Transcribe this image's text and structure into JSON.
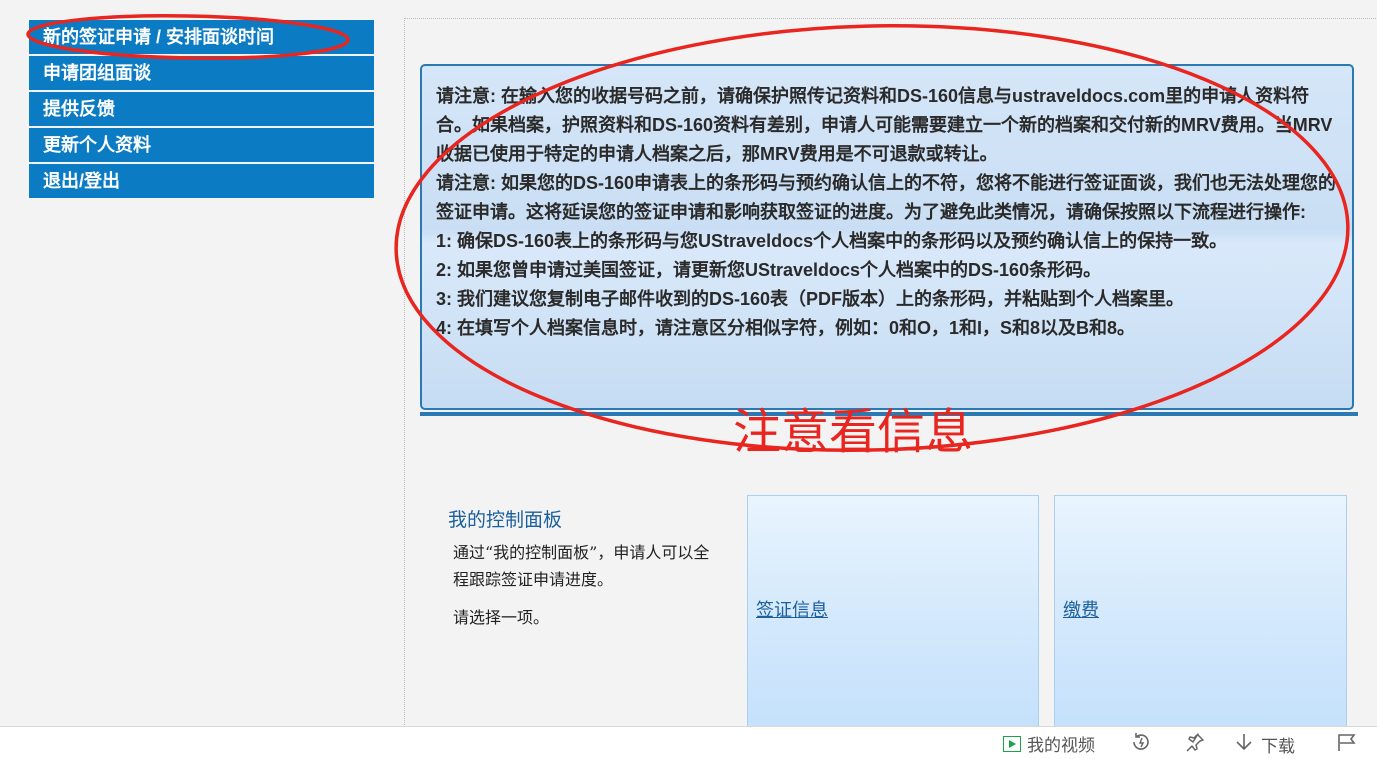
{
  "nav": {
    "items": [
      {
        "label": "新的签证申请 / 安排面谈时间"
      },
      {
        "label": "申请团组面谈"
      },
      {
        "label": "提供反馈"
      },
      {
        "label": "更新个人资料"
      },
      {
        "label": "退出/登出"
      }
    ]
  },
  "notice": {
    "p1": "请注意: 在输入您的收据号码之前，请确保护照传记资料和DS-160信息与ustraveldocs.com里的申请人资料符合。如果档案，护照资料和DS-160资料有差别，申请人可能需要建立一个新的档案和交付新的MRV费用。当MRV收据已使用于特定的申请人档案之后，那MRV费用是不可退款或转让。",
    "p2": "请注意: 如果您的DS-160申请表上的条形码与预约确认信上的不符，您将不能进行签证面谈，我们也无法处理您的签证申请。这将延误您的签证申请和影响获取签证的进度。为了避免此类情况，请确保按照以下流程进行操作:",
    "steps": [
      "1: 确保DS-160表上的条形码与您UStraveldocs个人档案中的条形码以及预约确认信上的保持一致。",
      "2: 如果您曾申请过美国签证，请更新您UStraveldocs个人档案中的DS-160条形码。",
      "3: 我们建议您复制电子邮件收到的DS-160表（PDF版本）上的条形码，并粘贴到个人档案里。",
      "4: 在填写个人档案信息时，请注意区分相似字符，例如：0和O，1和I，S和8以及B和8。"
    ]
  },
  "annotation": {
    "text": "注意看信息",
    "color": "#e8251f"
  },
  "dashboard": {
    "title": "我的控制面板",
    "description": "通过“我的控制面板”，申请人可以全程跟踪签证申请进度。",
    "choose": "请选择一项。",
    "cards": [
      {
        "label": "签证信息"
      },
      {
        "label": "缴费"
      }
    ]
  },
  "bottom_bar": {
    "my_videos": "我的视频",
    "download": "下载",
    "icons": [
      "play-icon",
      "refresh-icon",
      "pin-icon",
      "download-arrow-icon",
      "flag-icon"
    ]
  },
  "colors": {
    "nav_bg": "#0b7cc4",
    "notice_border": "#2b79b3",
    "link": "#1c5f9e"
  }
}
